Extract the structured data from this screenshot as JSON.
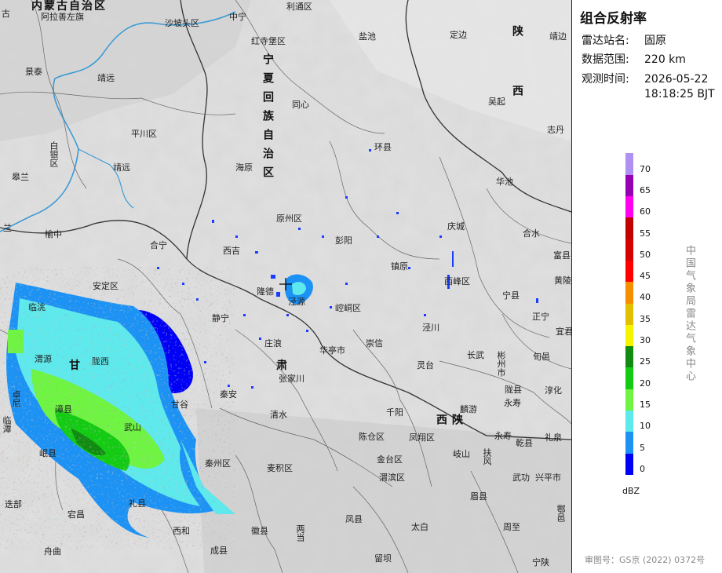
{
  "panel": {
    "title": "组合反射率",
    "station": {
      "label": "雷达站名:",
      "value": "固原"
    },
    "range": {
      "label": "数据范围:",
      "value": "220 km"
    },
    "time": {
      "label": "观测时间:",
      "date": "2026-05-22",
      "clock": "18:18:25 BJT"
    },
    "unit": "dBZ",
    "agency": "中国气象局雷达气象中心",
    "approval": "审图号：GS京 (2022) 0372号",
    "legend": [
      {
        "label": "0",
        "color": "#0000f6"
      },
      {
        "label": "5",
        "color": "#1c92f5"
      },
      {
        "label": "10",
        "color": "#5ee9ec"
      },
      {
        "label": "15",
        "color": "#6ef441"
      },
      {
        "label": "20",
        "color": "#14cb14"
      },
      {
        "label": "25",
        "color": "#118b11"
      },
      {
        "label": "30",
        "color": "#f4f400"
      },
      {
        "label": "35",
        "color": "#e1c000"
      },
      {
        "label": "40",
        "color": "#f68f00"
      },
      {
        "label": "45",
        "color": "#ff0000"
      },
      {
        "label": "50",
        "color": "#d70000"
      },
      {
        "label": "55",
        "color": "#c10000"
      },
      {
        "label": "60",
        "color": "#ff00f0"
      },
      {
        "label": "65",
        "color": "#9600b4"
      },
      {
        "label": "70",
        "color": "#ae91f2"
      }
    ]
  },
  "map": {
    "regions": {
      "neimenggu": "内蒙古自治区",
      "ningxia": "宁夏回族自治区",
      "gansu": "甘肃",
      "shaanxi_north": "陕西",
      "shaanxi_south": "陕西"
    },
    "places": [
      "阿拉善左旗",
      "沙坡头区",
      "中宁",
      "利通区",
      "盐池",
      "定边",
      "靖边",
      "古",
      "景泰",
      "靖远",
      "红寺堡区",
      "同心",
      "吴起",
      "平川区",
      "环县",
      "志丹",
      "白银区",
      "海原",
      "皋兰",
      "靖远",
      "华池",
      "原州区",
      "兰",
      "榆中",
      "彭阳",
      "庆城",
      "合水",
      "富县",
      "合宁",
      "西吉",
      "镇原",
      "西峰区",
      "宁县",
      "黄陵",
      "安定区",
      "隆德",
      "泾源",
      "崆峒区",
      "正宁",
      "临洮",
      "静宁",
      "泾川",
      "宜君",
      "渭源",
      "陇西",
      "庄浪",
      "华亭市",
      "崇信",
      "灵台",
      "长武",
      "彬州市",
      "旬邑",
      "张家川",
      "淳化",
      "卓尼",
      "漳县",
      "甘谷",
      "秦安",
      "陇县",
      "千阳",
      "麟游",
      "永寿",
      "临潭",
      "武山",
      "清水",
      "凤翔区",
      "永寿",
      "乾县",
      "礼泉",
      "岷县",
      "秦州区",
      "麦积区",
      "陈仓区",
      "岐山",
      "扶风",
      "武功",
      "兴平市",
      "迭部",
      "宕昌",
      "礼县",
      "金台区",
      "渭滨区",
      "眉县",
      "舟曲",
      "西和",
      "徽县",
      "两当",
      "凤县",
      "太白",
      "周至",
      "鄠邑",
      "成县",
      "留坝",
      "宁陕"
    ]
  }
}
